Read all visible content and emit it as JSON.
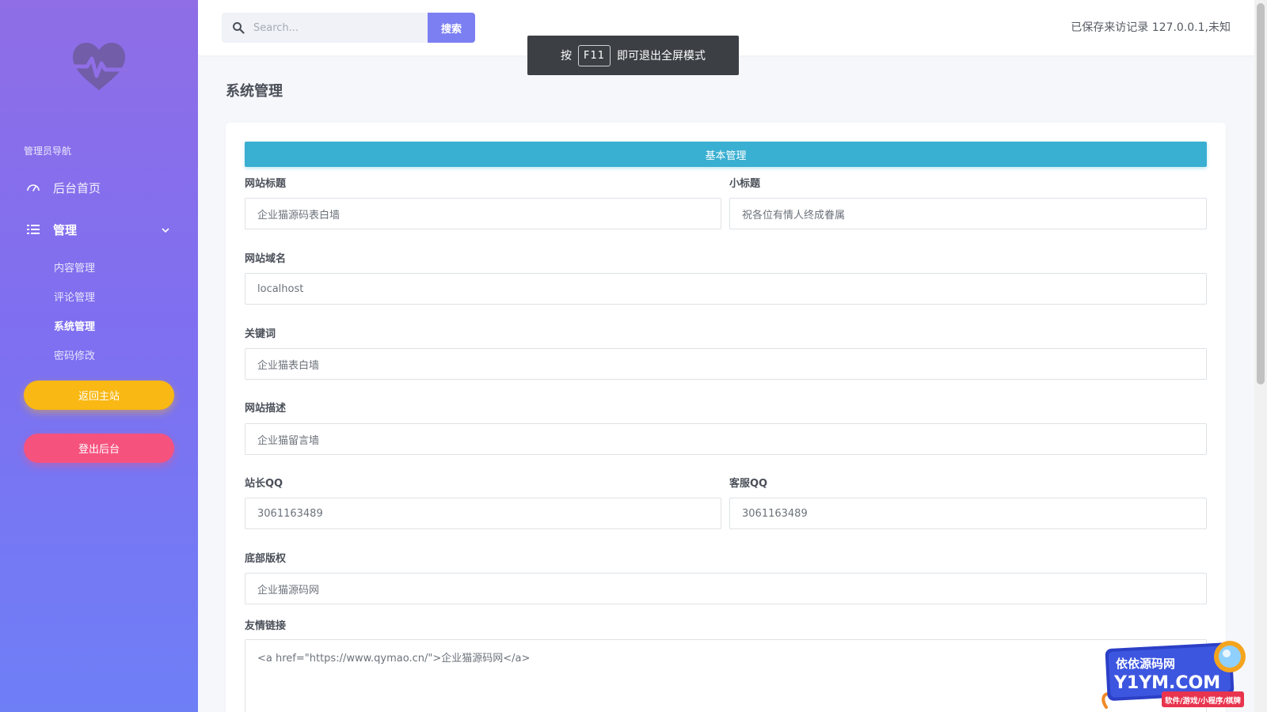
{
  "sidebar": {
    "nav_title": "管理员导航",
    "items": [
      {
        "label": "后台首页",
        "icon": "dashboard-gauge-icon"
      },
      {
        "label": "管理",
        "icon": "list-icon"
      }
    ],
    "sub_items": [
      {
        "label": "内容管理",
        "active": false
      },
      {
        "label": "评论管理",
        "active": false
      },
      {
        "label": "系统管理",
        "active": true
      },
      {
        "label": "密码修改",
        "active": false
      }
    ],
    "return_label": "返回主站",
    "logout_label": "登出后台"
  },
  "topbar": {
    "search_placeholder": "Search...",
    "search_button": "搜索",
    "visit_info": "已保存来访记录 127.0.0.1,未知"
  },
  "toast": {
    "prefix": "按",
    "key": "F11",
    "suffix": "即可退出全屏模式"
  },
  "main": {
    "page_title": "系统管理",
    "section_title": "基本管理",
    "fields": {
      "site_title": {
        "label": "网站标题",
        "value": "企业猫源码表白墙"
      },
      "subtitle": {
        "label": "小标题",
        "value": "祝各位有情人终成眷属"
      },
      "domain": {
        "label": "网站域名",
        "value": "localhost"
      },
      "keywords": {
        "label": "关键词",
        "value": "企业猫表白墙"
      },
      "description": {
        "label": "网站描述",
        "value": "企业猫留言墙"
      },
      "owner_qq": {
        "label": "站长QQ",
        "value": "3061163489"
      },
      "service_qq": {
        "label": "客服QQ",
        "value": "3061163489"
      },
      "copyright": {
        "label": "底部版权",
        "value": "企业猫源码网"
      },
      "links": {
        "label": "友情链接",
        "value": "<a href=\"https://www.qymao.cn/\">企业猫源码网</a>"
      }
    }
  },
  "watermark": {
    "line1": "依依源码网",
    "line2": "Y1YM.COM",
    "line3": "软件/游戏/小程序/棋牌"
  },
  "colors": {
    "sidebar_top": "#8f6ee6",
    "sidebar_bottom": "#6e7ff6",
    "search_button": "#7c7ff2",
    "section_bar": "#39afd1",
    "return_button": "#f9b814",
    "logout_button": "#f6527e"
  }
}
